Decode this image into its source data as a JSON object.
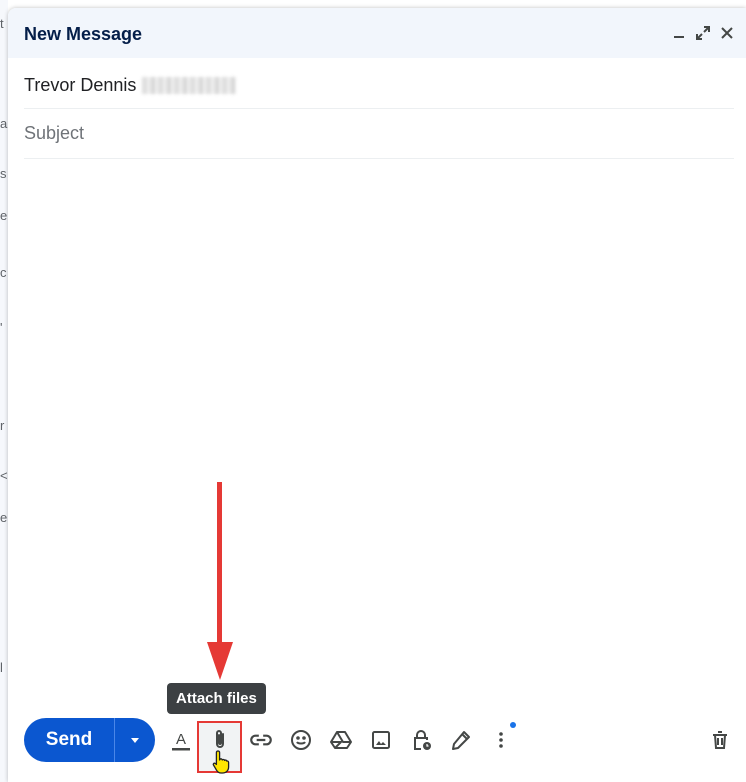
{
  "background": {
    "chars": [
      "t",
      "a",
      "s",
      "e",
      "c",
      "'",
      "r",
      "<",
      "e",
      "l"
    ]
  },
  "compose": {
    "title": "New Message",
    "header_icons": [
      "minimize-icon",
      "expand-icon",
      "close-icon"
    ],
    "to": {
      "name": "Trevor Dennis"
    },
    "subject": {
      "value": "",
      "placeholder": "Subject"
    },
    "body": {
      "value": ""
    },
    "send_label": "Send",
    "toolbar": {
      "icons": [
        "format-text-icon",
        "paperclip-icon",
        "link-icon",
        "emoji-icon",
        "drive-icon",
        "image-icon",
        "lock-clock-icon",
        "pen-icon",
        "more-vert-icon",
        "trash-icon"
      ],
      "tooltip": "Attach files"
    },
    "colors": {
      "send_button": "#0b57d0",
      "header_bg": "#f2f6fc",
      "annotation": "#e53935",
      "notification_dot": "#1a73e8"
    }
  }
}
